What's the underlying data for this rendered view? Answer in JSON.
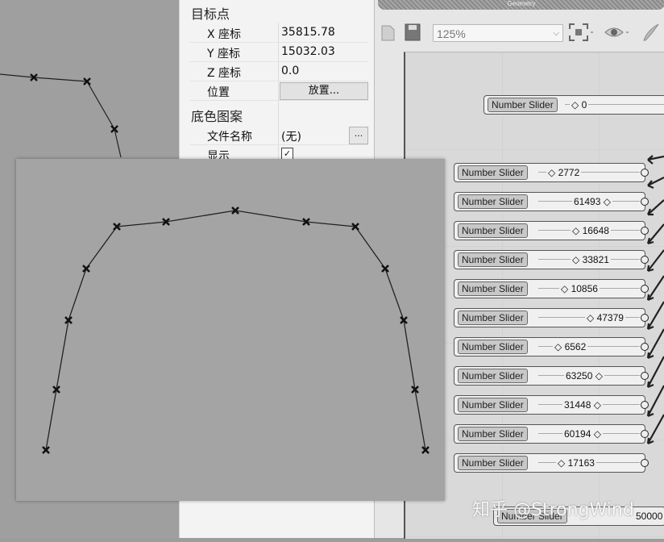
{
  "properties": {
    "target_section": "目标点",
    "rows": [
      {
        "key": "X 座标",
        "value": "35815.78"
      },
      {
        "key": "Y 座标",
        "value": "15032.03"
      },
      {
        "key": "Z 座标",
        "value": "0.0"
      },
      {
        "key": "位置",
        "value": "放置..."
      }
    ],
    "bg_section": "底色图案",
    "file_name_label": "文件名称",
    "file_name_value": "(无)",
    "browse_label": "...",
    "show_label": "显示",
    "show_checked": "✓"
  },
  "grasshopper": {
    "ribbon_label": "Geometry",
    "zoom_value": "125%",
    "top_slider": {
      "label": "Number Slider",
      "value": "◇ 0"
    },
    "sliders": [
      {
        "label": "Number Slider",
        "value": "◇ 2772"
      },
      {
        "label": "Number Slider",
        "value": "61493 ◇"
      },
      {
        "label": "Number Slider",
        "value": "◇ 16648"
      },
      {
        "label": "Number Slider",
        "value": "◇ 33821"
      },
      {
        "label": "Number Slider",
        "value": "◇ 10856"
      },
      {
        "label": "Number Slider",
        "value": "◇ 47379"
      },
      {
        "label": "Number Slider",
        "value": "◇ 6562"
      },
      {
        "label": "Number Slider",
        "value": "63250 ◇"
      },
      {
        "label": "Number Slider",
        "value": "31448 ◇"
      },
      {
        "label": "Number Slider",
        "value": "60194 ◇"
      },
      {
        "label": "Number Slider",
        "value": "◇ 17163"
      }
    ],
    "bottom_slider": {
      "label": "Number Slider",
      "value": "50000"
    }
  },
  "watermark": "知乎 @StrongWind"
}
